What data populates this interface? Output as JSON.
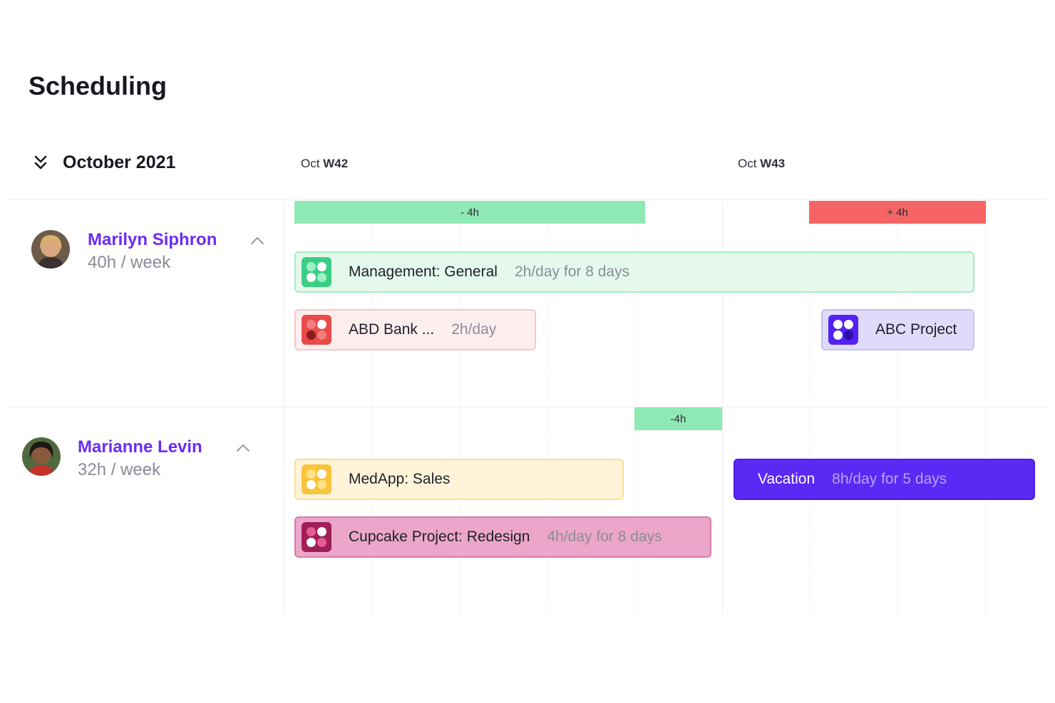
{
  "page": {
    "title": "Scheduling"
  },
  "calendar": {
    "month": "October 2021",
    "weeks": [
      {
        "month": "Oct",
        "week": "W42"
      },
      {
        "month": "Oct",
        "week": "W43"
      }
    ]
  },
  "people": [
    {
      "name": "Marilyn Siphron",
      "hours": "40h / week",
      "capacity": [
        {
          "label": "- 4h",
          "status": "under"
        },
        {
          "label": "+ 4h",
          "status": "over"
        }
      ],
      "tasks": [
        {
          "name": "Management: General",
          "meta": "2h/day for 8 days"
        },
        {
          "name": "ABD Bank ...",
          "meta": "2h/day"
        },
        {
          "name": "ABC Project",
          "meta": ""
        }
      ]
    },
    {
      "name": "Marianne Levin",
      "hours": "32h / week",
      "capacity": [
        {
          "label": "-4h",
          "status": "under"
        }
      ],
      "tasks": [
        {
          "name": "MedApp: Sales",
          "meta": ""
        },
        {
          "name": "Cupcake Project: Redesign",
          "meta": "4h/day for 8 days"
        },
        {
          "name": "Vacation",
          "meta": "8h/day for 5 days"
        }
      ]
    }
  ],
  "icons": {
    "month_toggle": "chevrons-down-icon",
    "collapse": "chevron-up-icon",
    "project": "project-tile-icon"
  },
  "colors": {
    "accent": "#6b2cf5",
    "under_capacity": "#8fe9b5",
    "over_capacity": "#f66565",
    "vacation": "#5a29f4"
  }
}
